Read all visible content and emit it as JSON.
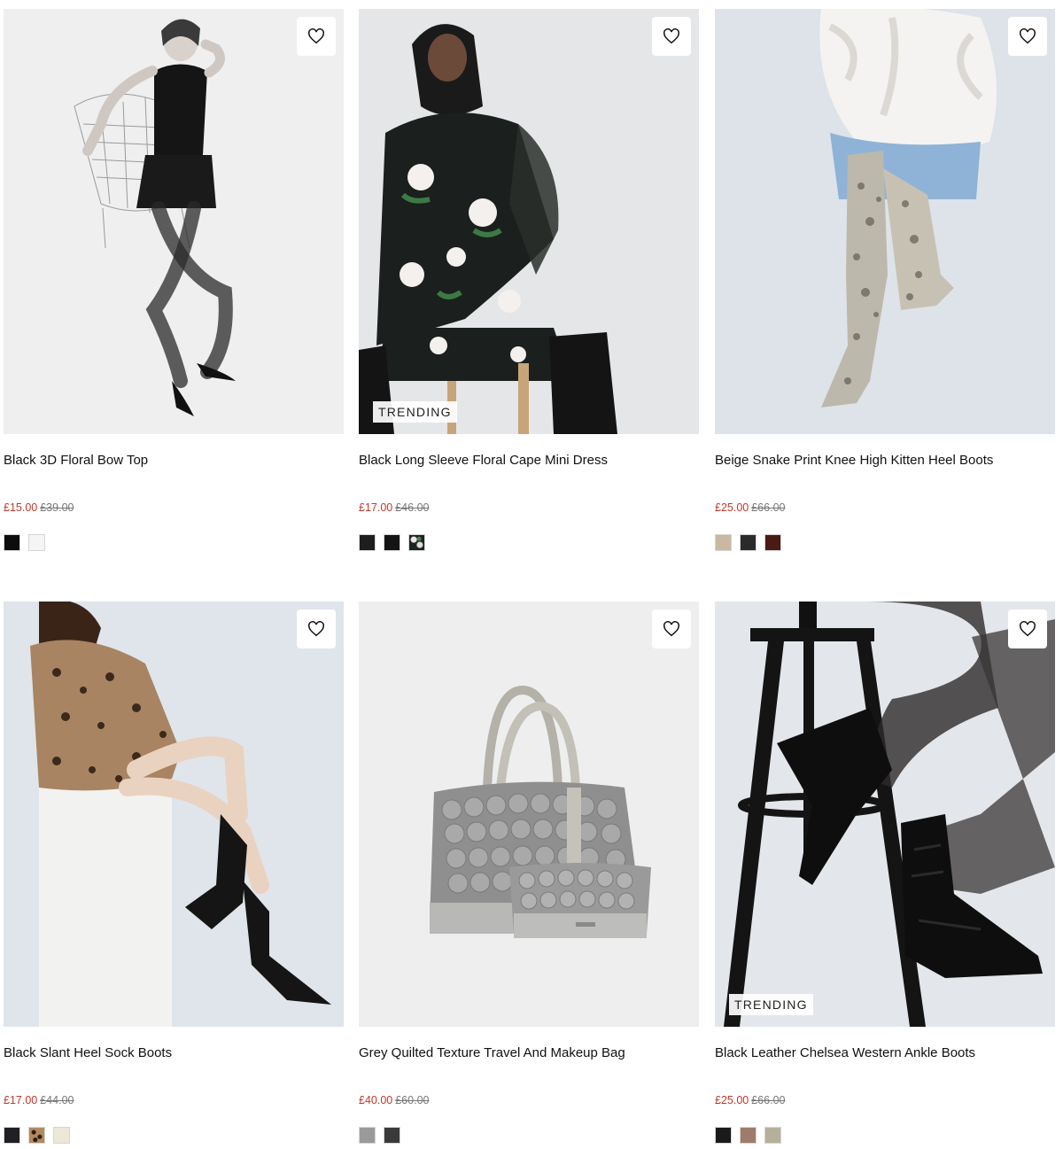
{
  "products": [
    {
      "title": "Black 3D Floral Bow Top",
      "price_now": "£15.00",
      "price_was": "£39.00",
      "badge": "",
      "image_icon": "model-photo",
      "swatches": [
        "#0d0d0d",
        "#f5f5f5"
      ]
    },
    {
      "title": "Black Long Sleeve Floral Cape Mini Dress",
      "price_now": "£17.00",
      "price_was": "£46.00",
      "badge": "TRENDING",
      "image_icon": "model-photo",
      "swatches": [
        "#1e1e1e",
        "#141414",
        "floral-pattern"
      ]
    },
    {
      "title": "Beige Snake Print Knee High Kitten Heel Boots",
      "price_now": "£25.00",
      "price_was": "£66.00",
      "badge": "",
      "image_icon": "model-photo",
      "swatches": [
        "#c9b9a3",
        "#2b2b2b",
        "#4a1a14"
      ]
    },
    {
      "title": "Black Slant Heel Sock Boots",
      "price_now": "£17.00",
      "price_was": "£44.00",
      "badge": "",
      "image_icon": "model-photo",
      "swatches": [
        "#1f1f24",
        "leopard-pattern",
        "#ece7d8"
      ]
    },
    {
      "title": "Grey Quilted Texture Travel And Makeup Bag",
      "price_now": "£40.00",
      "price_was": "£60.00",
      "badge": "",
      "image_icon": "bag-photo",
      "swatches": [
        "#9a9a9a",
        "#3a3a3a"
      ]
    },
    {
      "title": "Black Leather Chelsea Western Ankle Boots",
      "price_now": "£25.00",
      "price_was": "£66.00",
      "badge": "TRENDING",
      "image_icon": "model-photo",
      "swatches": [
        "#1a1a1a",
        "#a07a6a",
        "#b5b09a"
      ]
    }
  ]
}
